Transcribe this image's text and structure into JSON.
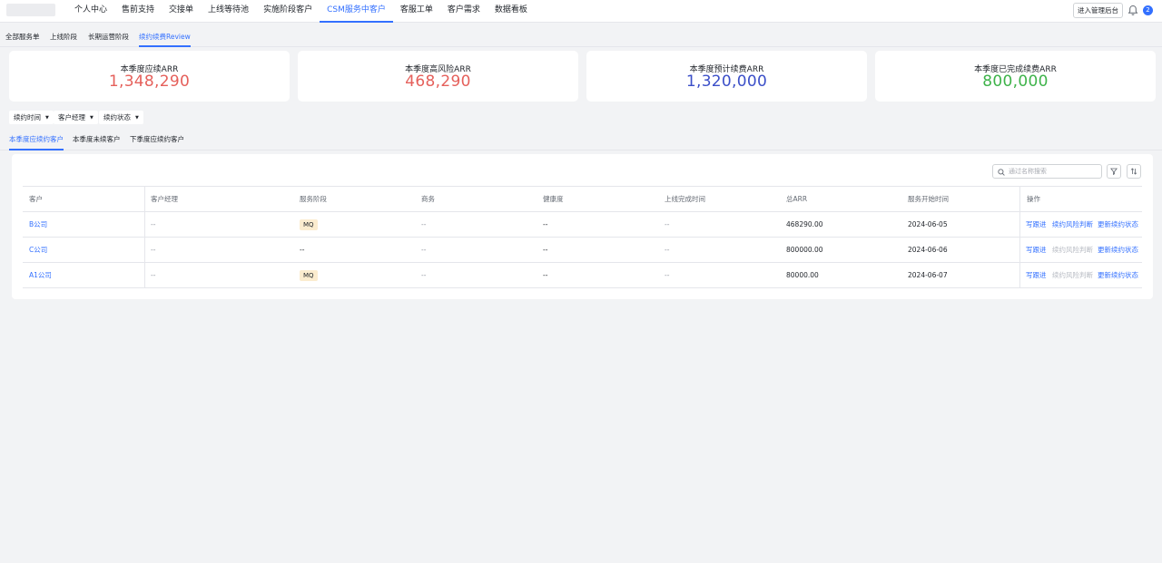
{
  "nav": {
    "items": [
      "个人中心",
      "售前支持",
      "交接单",
      "上线等待池",
      "实施阶段客户",
      "CSM服务中客户",
      "客服工单",
      "客户需求",
      "数据看板"
    ],
    "active_index": 5,
    "admin_button": "进入管理后台",
    "avatar_text": "2"
  },
  "subtabs": {
    "items": [
      "全部服务单",
      "上线阶段",
      "长期运营阶段",
      "续约续费Review"
    ],
    "active_index": 3
  },
  "stats": [
    {
      "label": "本季度应续ARR",
      "value": "1,348,290",
      "color": "#e5605b"
    },
    {
      "label": "本季度高风险ARR",
      "value": "468,290",
      "color": "#e5605b"
    },
    {
      "label": "本季度预计续费ARR",
      "value": "1,320,000",
      "color": "#3b4fc8"
    },
    {
      "label": "本季度已完成续费ARR",
      "value": "800,000",
      "color": "#3eb34a"
    }
  ],
  "filters": [
    "续约时间",
    "客户经理",
    "续约状态"
  ],
  "customer_tabs": {
    "items": [
      "本季度应续约客户",
      "本季度未续客户",
      "下季度应续约客户"
    ],
    "active_index": 0
  },
  "table": {
    "search_placeholder": "通过名称搜索",
    "columns": [
      "客户",
      "客户经理",
      "服务阶段",
      "商务",
      "健康度",
      "上线完成时间",
      "总ARR",
      "服务开始时间",
      "操作"
    ],
    "rows": [
      {
        "customer": "B公司",
        "manager": "--",
        "stage": "MQ",
        "stage_is_tag": true,
        "business": "--",
        "health": "--",
        "golive": "--",
        "arr": "468290.00",
        "start": "2024-06-05",
        "risk_enabled": true
      },
      {
        "customer": "C公司",
        "manager": "--",
        "stage": "--",
        "stage_is_tag": false,
        "business": "--",
        "health": "--",
        "golive": "--",
        "arr": "800000.00",
        "start": "2024-06-06",
        "risk_enabled": false
      },
      {
        "customer": "A1公司",
        "manager": "--",
        "stage": "MQ",
        "stage_is_tag": true,
        "business": "--",
        "health": "--",
        "golive": "--",
        "arr": "80000.00",
        "start": "2024-06-07",
        "risk_enabled": false
      }
    ],
    "actions": [
      "写跟进",
      "续约风险判断",
      "更新续约状态"
    ]
  }
}
